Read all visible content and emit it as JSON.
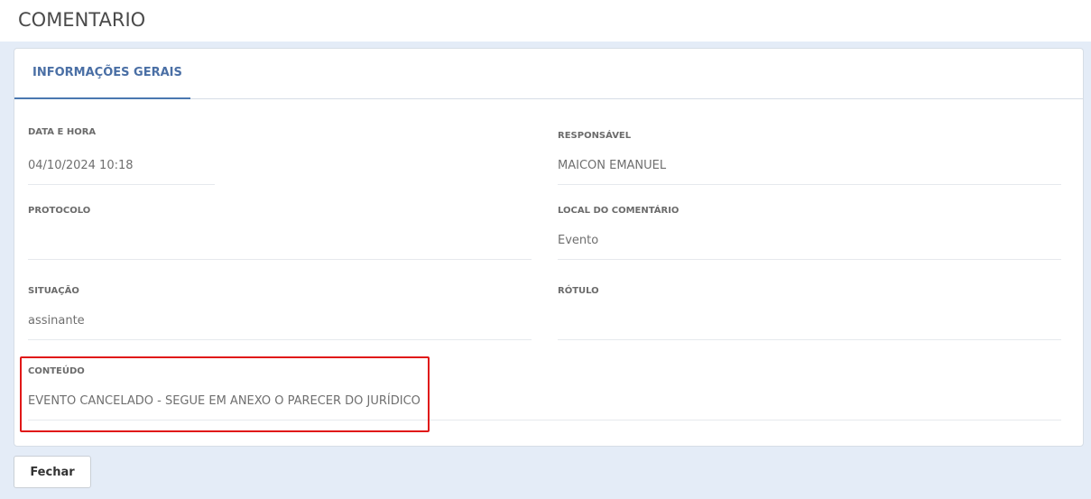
{
  "header": {
    "title": "COMENTARIO"
  },
  "tabs": [
    {
      "label": "INFORMAÇÕES GERAIS",
      "active": true
    }
  ],
  "fields": {
    "data_hora": {
      "label": "DATA E HORA",
      "value": "04/10/2024 10:18"
    },
    "responsavel": {
      "label": "RESPONSÁVEL",
      "value": "MAICON EMANUEL"
    },
    "protocolo": {
      "label": "PROTOCOLO",
      "value": ""
    },
    "local": {
      "label": "LOCAL DO COMENTÁRIO",
      "value": "Evento"
    },
    "situacao": {
      "label": "SITUAÇÃO",
      "value": "assinante"
    },
    "rotulo": {
      "label": "RÓTULO",
      "value": ""
    },
    "conteudo": {
      "label": "CONTEÚDO",
      "value": "EVENTO CANCELADO - SEGUE EM ANEXO O PARECER DO JURÍDICO"
    }
  },
  "footer": {
    "close_label": "Fechar"
  },
  "colors": {
    "accent": "#4a6fa5",
    "highlight": "#e01818",
    "background": "#e4ecf7"
  }
}
